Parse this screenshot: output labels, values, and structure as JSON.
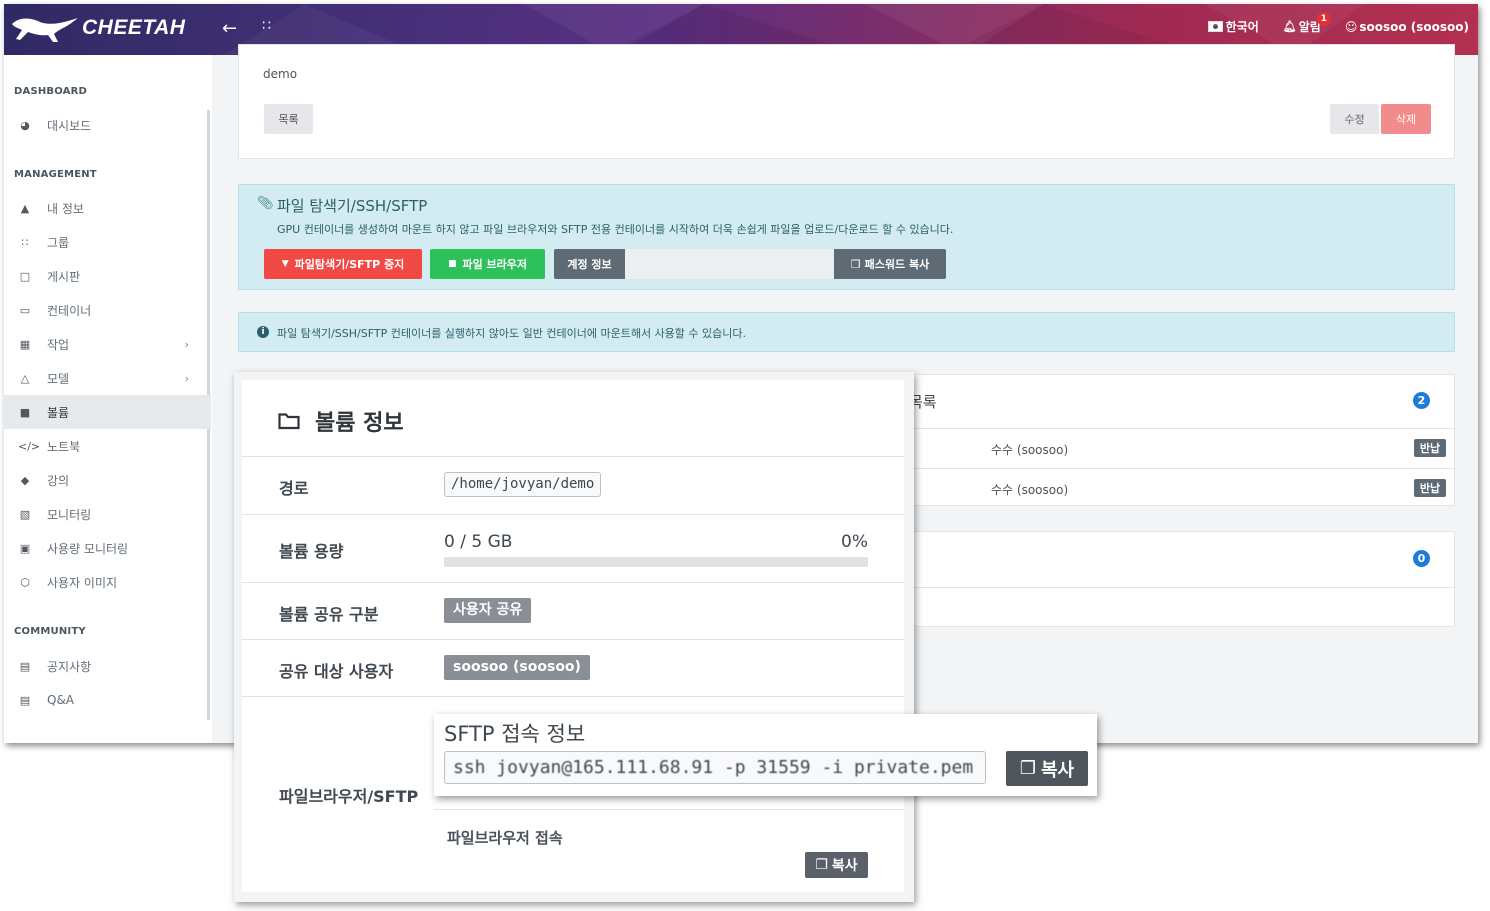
{
  "header": {
    "logo": "CHEETAH",
    "language": "한국어",
    "notifications_label": "알림",
    "notifications_count": "1",
    "user": "soosoo (soosoo)"
  },
  "sidebar": {
    "sections": [
      "DASHBOARD",
      "MANAGEMENT",
      "COMMUNITY"
    ],
    "dashboard_items": [
      {
        "label": "대시보드",
        "icon": "dashboard-icon"
      }
    ],
    "management_items": [
      {
        "label": "내 정보",
        "icon": "user-icon"
      },
      {
        "label": "그룹",
        "icon": "group-icon"
      },
      {
        "label": "게시판",
        "icon": "board-icon"
      },
      {
        "label": "컨테이너",
        "icon": "monitor-icon"
      },
      {
        "label": "작업",
        "icon": "calendar-icon"
      },
      {
        "label": "모델",
        "icon": "bell-icon"
      },
      {
        "label": "볼륨",
        "icon": "folder-icon"
      },
      {
        "label": "노트북",
        "icon": "code-icon"
      },
      {
        "label": "강의",
        "icon": "graduation-cap-icon"
      },
      {
        "label": "모니터링",
        "icon": "chart-icon"
      },
      {
        "label": "사용량 모니터링",
        "icon": "usage-icon"
      },
      {
        "label": "사용자 이미지",
        "icon": "image-icon"
      }
    ],
    "community_items": [
      {
        "label": "공지사항",
        "icon": "comments-icon"
      },
      {
        "label": "Q&A",
        "icon": "comments-icon"
      }
    ],
    "active": "볼륨"
  },
  "top_card": {
    "name": "demo",
    "list_button": "목록",
    "edit_button": "수정",
    "delete_button": "삭제"
  },
  "sftp_box": {
    "title": "파일 탐색기/SSH/SFTP",
    "description": "GPU 컨테이너를 생성하여 마운트 하지 않고 파일 브라우저와 SFTP 전용 컨테이너를 시작하여 더욱 손쉽게 파일을 업로드/다운로드 할 수 있습니다.",
    "stop_button": "파일탐색기/SFTP 중지",
    "browser_button": "파일 브라우저",
    "account_button": "계정 정보",
    "account_value": "",
    "copy_password_button": "패스워드 복사"
  },
  "notice_box": {
    "text": "파일 탐색기/SSH/SFTP 컨테이너를 실행하지 않아도 일반 컨테이너에 마운트해서 사용할 수 있습니다."
  },
  "right_lists": {
    "list1_title": "목록",
    "list1_count": "2",
    "rows": [
      {
        "user": "수수 (soosoo)",
        "action": "반납"
      },
      {
        "user": "수수 (soosoo)",
        "action": "반납"
      }
    ],
    "list2_count": "0"
  },
  "volume_info": {
    "title": "볼륨 정보",
    "path_label": "경로",
    "path_value": "/home/jovyan/demo",
    "capacity_label": "볼륨 용량",
    "capacity_value": "0 / 5 GB",
    "capacity_percent": "0%",
    "capacity_fraction": 0,
    "share_type_label": "볼륨 공유 구분",
    "share_type_value": "사용자 공유",
    "share_users_label": "공유 대상 사용자",
    "share_users_value": "soosoo (soosoo)",
    "sftp_label": "파일브라우저/SFTP",
    "sftp_title": "SFTP 접속 정보",
    "sftp_command": "ssh jovyan@165.111.68.91 -p 31559 -i private.pem",
    "sftp_copy_button": "복사",
    "browser_access_label": "파일브라우저 접속",
    "browser_copy_button": "복사"
  }
}
